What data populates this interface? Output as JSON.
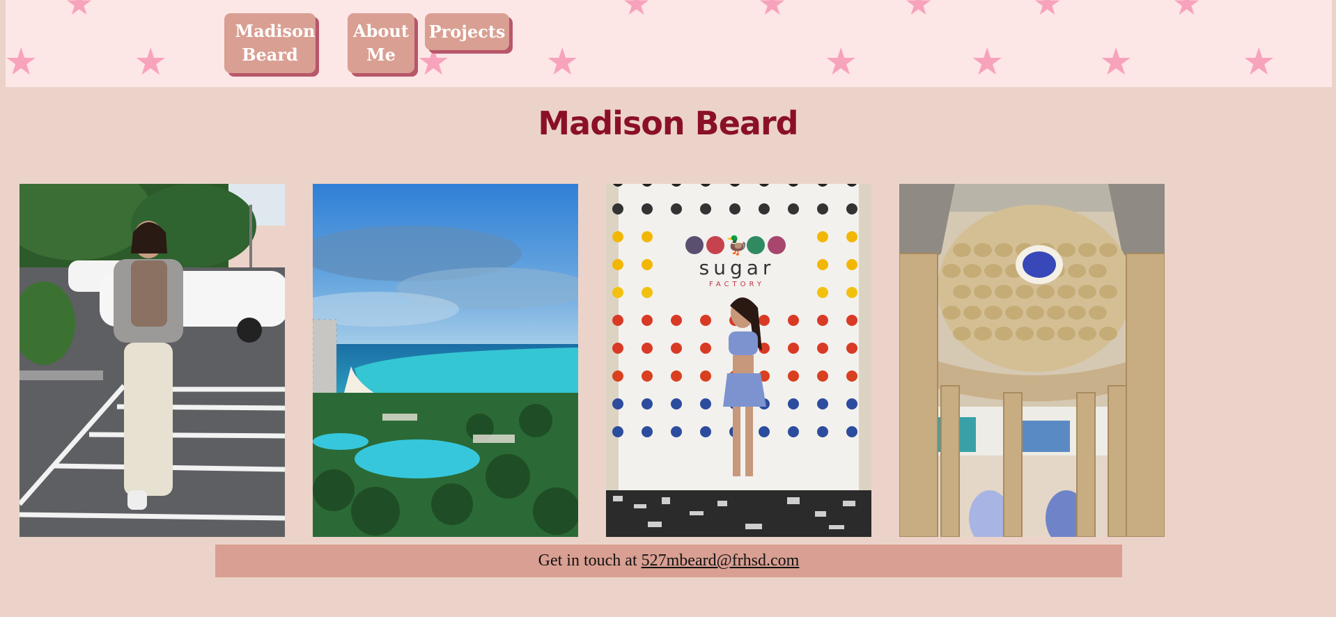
{
  "nav": {
    "home_label": "Madison Beard",
    "about_label": "About Me",
    "projects_label": "Projects"
  },
  "page_title": "Madison Beard",
  "photos": [
    {
      "icon": "photo-parking-lot-portrait"
    },
    {
      "icon": "photo-beach-resort"
    },
    {
      "icon": "photo-sugar-factory-wall"
    },
    {
      "icon": "photo-ornate-dome-ceiling"
    }
  ],
  "sugar_wall": {
    "brand": "sugar",
    "sub": "FACTORY"
  },
  "footer": {
    "prefix": "Get in touch at",
    "email": "527mbeard@frhsd.com"
  },
  "colors": {
    "background": "#ecd3ca",
    "header": "#fde6e6",
    "stars": "#f7a3bc",
    "button": "#d99f92",
    "button_shadow": "#b8566a",
    "title": "#8a1028"
  }
}
